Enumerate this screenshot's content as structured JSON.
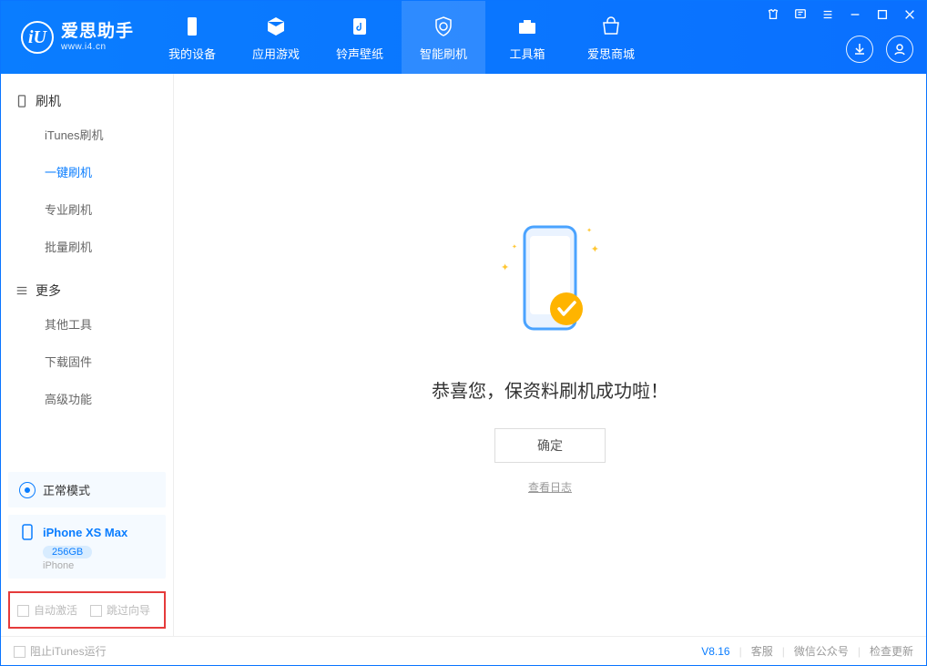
{
  "logo": {
    "initial": "iU",
    "title": "爱思助手",
    "subtitle": "www.i4.cn"
  },
  "tabs": [
    "我的设备",
    "应用游戏",
    "铃声壁纸",
    "智能刷机",
    "工具箱",
    "爱思商城"
  ],
  "sidebar": {
    "group1": {
      "title": "刷机",
      "items": [
        "iTunes刷机",
        "一键刷机",
        "专业刷机",
        "批量刷机"
      ]
    },
    "group2": {
      "title": "更多",
      "items": [
        "其他工具",
        "下载固件",
        "高级功能"
      ]
    }
  },
  "device": {
    "mode": "正常模式",
    "name": "iPhone XS Max",
    "storage": "256GB",
    "type": "iPhone"
  },
  "checks": {
    "auto_activate": "自动激活",
    "skip_guide": "跳过向导"
  },
  "main": {
    "message": "恭喜您，保资料刷机成功啦！",
    "confirm": "确定",
    "view_log": "查看日志"
  },
  "status": {
    "block_itunes": "阻止iTunes运行",
    "version": "V8.16",
    "links": [
      "客服",
      "微信公众号",
      "检查更新"
    ]
  }
}
